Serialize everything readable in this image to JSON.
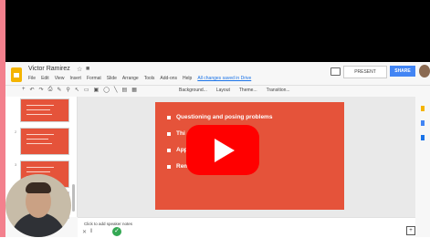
{
  "document": {
    "title": "Victor Ramirez",
    "saved_status": "All changes saved in Drive"
  },
  "menu": [
    "File",
    "Edit",
    "View",
    "Insert",
    "Format",
    "Slide",
    "Arrange",
    "Tools",
    "Add-ons",
    "Help"
  ],
  "header": {
    "present_label": "PRESENT",
    "share_label": "SHARE"
  },
  "toolbar": {
    "background_label": "Background...",
    "layout_label": "Layout",
    "theme_label": "Theme...",
    "transition_label": "Transition..."
  },
  "filmstrip": {
    "slide_numbers": [
      "2",
      "3",
      "4"
    ]
  },
  "slide": {
    "bullets": [
      "Questioning and posing problems",
      "Thi",
      "App            e situations",
      "Rem                learning"
    ]
  },
  "notes": {
    "placeholder": "Click to add speaker notes"
  },
  "colors": {
    "slide_bg": "#e5533a",
    "share_blue": "#4285f4",
    "logo_yellow": "#f4b400",
    "play_red": "#ff0000"
  }
}
